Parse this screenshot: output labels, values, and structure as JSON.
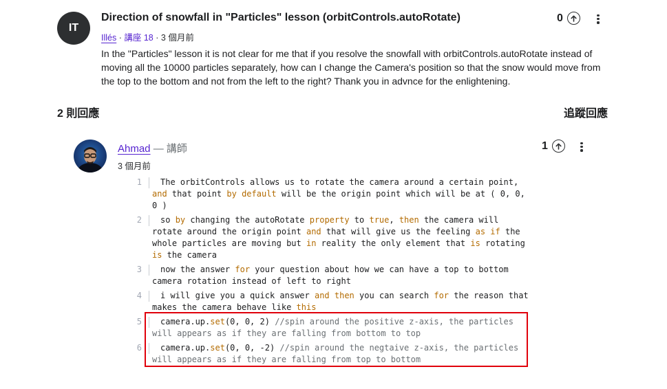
{
  "question": {
    "avatar_initials": "IT",
    "title": "Direction of snowfall in \"Particles\" lesson (orbitControls.autoRotate)",
    "author": "Illés",
    "lecture": "講座 18",
    "time": "3 個月前",
    "sep": "·",
    "votes": "0",
    "body": "In the \"Particles\" lesson it is not clear for me that if you resolve the snowfall with orbitControls.autoRotate instead of moving all the 10000 particles separately, how can I change the Camera's position so that the snow would move from the top to the bottom and not from the left to the right? Thank you in advnce for the enlightening."
  },
  "replies_header": {
    "count_label": "2 則回應",
    "follow_label": "追蹤回應"
  },
  "reply": {
    "author": "Ahmad",
    "role": "— 講師",
    "time": "3 個月前",
    "votes": "1",
    "code_lines": [
      {
        "n": "1",
        "parts": [
          {
            "t": "The orbitControls allows us to rotate the camera around a certain point, "
          },
          {
            "t": "and",
            "k": "kw"
          },
          {
            "t": " that point "
          },
          {
            "t": "by default",
            "k": "kw"
          },
          {
            "t": " will be the origin point which will be at ( 0, 0, 0 )"
          }
        ]
      },
      {
        "n": "2",
        "parts": [
          {
            "t": "so "
          },
          {
            "t": "by",
            "k": "kw"
          },
          {
            "t": " changing the autoRotate "
          },
          {
            "t": "property",
            "k": "kw"
          },
          {
            "t": " to "
          },
          {
            "t": "true",
            "k": "kw"
          },
          {
            "t": ", "
          },
          {
            "t": "then",
            "k": "kw"
          },
          {
            "t": " the camera will rotate around the origin point "
          },
          {
            "t": "and",
            "k": "kw"
          },
          {
            "t": " that will give us the feeling "
          },
          {
            "t": "as if",
            "k": "kw"
          },
          {
            "t": " the whole particles are moving but "
          },
          {
            "t": "in",
            "k": "kw"
          },
          {
            "t": " reality the only element that "
          },
          {
            "t": "is",
            "k": "kw"
          },
          {
            "t": " rotating "
          },
          {
            "t": "is",
            "k": "kw"
          },
          {
            "t": " the camera"
          }
        ]
      },
      {
        "n": "3",
        "parts": [
          {
            "t": "now the answer "
          },
          {
            "t": "for",
            "k": "kw"
          },
          {
            "t": " your question about how we can have a top to bottom camera rotation instead of left to right"
          }
        ]
      },
      {
        "n": "4",
        "parts": [
          {
            "t": "i will give you a quick answer "
          },
          {
            "t": "and then",
            "k": "kw"
          },
          {
            "t": " you can search "
          },
          {
            "t": "for",
            "k": "kw"
          },
          {
            "t": " the reason that makes the camera behave like "
          },
          {
            "t": "this",
            "k": "kw"
          }
        ]
      },
      {
        "n": "5",
        "parts": [
          {
            "t": "camera.up."
          },
          {
            "t": "set",
            "k": "kw"
          },
          {
            "t": "(0, 0, 2) "
          },
          {
            "t": "//spin around the positive z-axis, the particles will appears as if they are falling from bottom to top",
            "k": "cm"
          }
        ]
      },
      {
        "n": "6",
        "parts": [
          {
            "t": "camera.up."
          },
          {
            "t": "set",
            "k": "kw"
          },
          {
            "t": "(0, 0, -2) "
          },
          {
            "t": "//spin around the negtaive z-axis, the particles will appears as if they are falling from top to bottom",
            "k": "cm"
          }
        ]
      }
    ]
  },
  "colors": {
    "accent": "#5624d0",
    "highlight_box": "#e0000a",
    "keyword": "#b36b00"
  },
  "icons": {
    "upvote": "arrow-up-circle-icon",
    "more": "more-vertical-icon"
  }
}
